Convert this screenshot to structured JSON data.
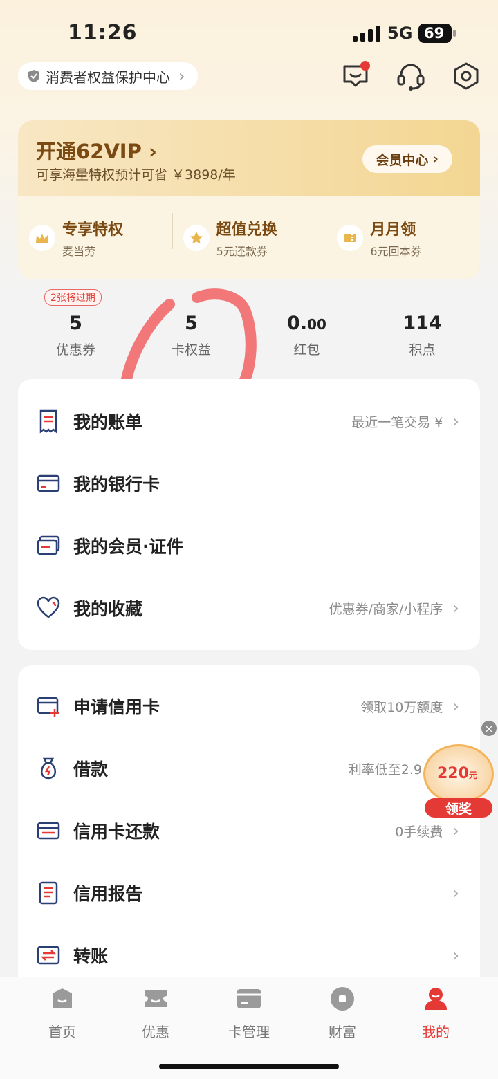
{
  "status_bar": {
    "time": "11:26",
    "network": "5G",
    "battery": "69"
  },
  "header": {
    "protect_label": "消费者权益保护中心"
  },
  "vip": {
    "title": "开通62VIP",
    "subtitle": "可享海量特权预计可省 ￥3898/年",
    "member_center": "会员中心",
    "perks": [
      {
        "title": "专享特权",
        "sub": "麦当劳"
      },
      {
        "title": "超值兑换",
        "sub": "5元还款券"
      },
      {
        "title": "月月领",
        "sub": "6元回本券"
      }
    ]
  },
  "stats": {
    "expire_badge": "2张将过期",
    "items": [
      {
        "value": "5",
        "label": "优惠券"
      },
      {
        "value": "5",
        "label": "卡权益"
      },
      {
        "value_main": "0.",
        "value_small": "00",
        "label": "红包"
      },
      {
        "value": "114",
        "label": "积点"
      }
    ]
  },
  "list1": [
    {
      "title": "我的账单",
      "right": "最近一笔交易 ¥",
      "icon": "bill-icon"
    },
    {
      "title": "我的银行卡",
      "right": "",
      "icon": "bank-card-icon"
    },
    {
      "title": "我的会员·证件",
      "right": "",
      "icon": "member-card-icon"
    },
    {
      "title": "我的收藏",
      "right": "优惠券/商家/小程序",
      "icon": "heart-icon"
    }
  ],
  "list2": [
    {
      "title": "申请信用卡",
      "right": "领取10万额度",
      "icon": "apply-card-icon"
    },
    {
      "title": "借款",
      "right": "利率低至2.9",
      "icon": "loan-bag-icon"
    },
    {
      "title": "信用卡还款",
      "right": "0手续费",
      "icon": "repay-icon"
    },
    {
      "title": "信用报告",
      "right": "",
      "icon": "report-icon"
    },
    {
      "title": "转账",
      "right": "",
      "icon": "transfer-icon"
    }
  ],
  "prize": {
    "amount": "220",
    "unit": "元",
    "button": "领奖",
    "close": "×"
  },
  "tabs": [
    {
      "label": "首页"
    },
    {
      "label": "优惠"
    },
    {
      "label": "卡管理"
    },
    {
      "label": "财富"
    },
    {
      "label": "我的"
    }
  ],
  "colors": {
    "accent": "#e53935",
    "gold_text": "#7a4a12",
    "icon_blue": "#2a3f73"
  }
}
